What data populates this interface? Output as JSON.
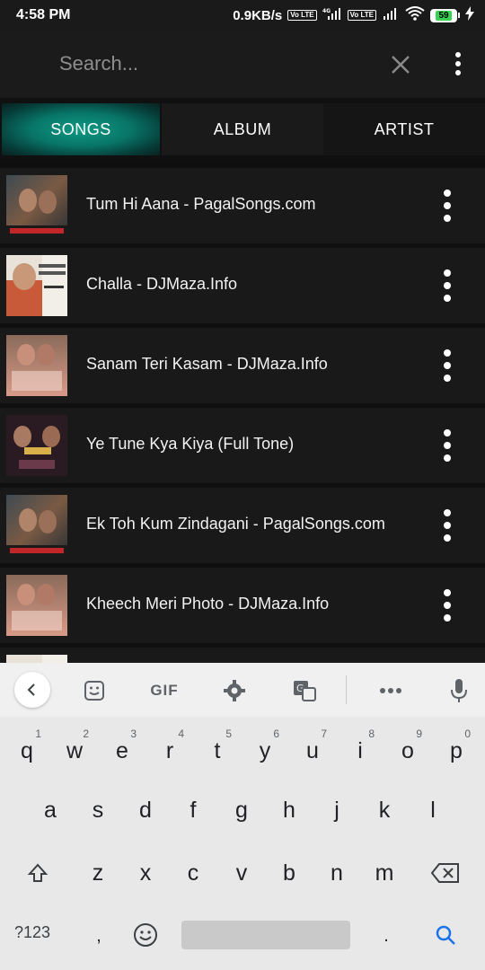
{
  "status_bar": {
    "time": "4:58 PM",
    "speed": "0.9KB/s",
    "volte1": "Vo LTE",
    "volte2": "Vo LTE",
    "network": "4G",
    "battery": "59"
  },
  "search": {
    "placeholder": "Search..."
  },
  "tabs": [
    {
      "label": "SONGS",
      "active": true
    },
    {
      "label": "ALBUM",
      "active": false
    },
    {
      "label": "ARTIST",
      "active": false
    }
  ],
  "songs": [
    {
      "title": "Tum Hi Aana - PagalSongs.com",
      "art": "Marjaavaan"
    },
    {
      "title": "Challa - DJMaza.Info",
      "art": "Emraan Hashmi"
    },
    {
      "title": "Sanam Teri Kasam - DJMaza.Info",
      "art": "Sanam Teri Kasam"
    },
    {
      "title": "Ye Tune Kya Kiya (Full Tone)",
      "art": "Once Upon A Time In Mumbaai"
    },
    {
      "title": "Ek Toh Kum Zindagani - PagalSongs.com",
      "art": "Marjaavaan"
    },
    {
      "title": "Kheech Meri Photo - DJMaza.Info",
      "art": "Sanam Teri Kasam"
    }
  ],
  "keyboard": {
    "toolbar": {
      "gif": "GIF"
    },
    "row1": [
      {
        "key": "q",
        "hint": "1"
      },
      {
        "key": "w",
        "hint": "2"
      },
      {
        "key": "e",
        "hint": "3"
      },
      {
        "key": "r",
        "hint": "4"
      },
      {
        "key": "t",
        "hint": "5"
      },
      {
        "key": "y",
        "hint": "6"
      },
      {
        "key": "u",
        "hint": "7"
      },
      {
        "key": "i",
        "hint": "8"
      },
      {
        "key": "o",
        "hint": "9"
      },
      {
        "key": "p",
        "hint": "0"
      }
    ],
    "row2": [
      "a",
      "s",
      "d",
      "f",
      "g",
      "h",
      "j",
      "k",
      "l"
    ],
    "row3": [
      "z",
      "x",
      "c",
      "v",
      "b",
      "n",
      "m"
    ],
    "symbols_label": "?123",
    "comma": ",",
    "period": "."
  },
  "colors": {
    "accent": "#0e9a85",
    "background": "#0f0f0f",
    "row_background": "#191919",
    "keyboard_background": "#e8e8e8",
    "search_icon_blue": "#1a73e8"
  }
}
